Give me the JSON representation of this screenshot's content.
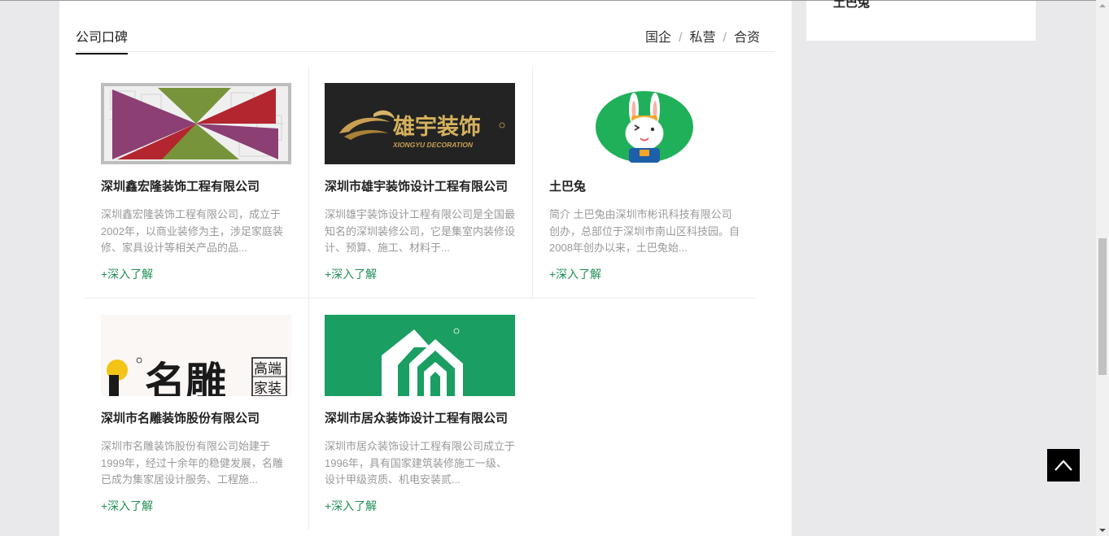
{
  "side_panel": {
    "cut_text": "土巴兔"
  },
  "section": {
    "title": "公司口碑",
    "filters": [
      "国企",
      "私营",
      "合资"
    ],
    "separator": "/"
  },
  "companies": [
    {
      "name": "深圳鑫宏隆装饰工程有限公司",
      "desc": "深圳鑫宏隆装饰工程有限公司，成立于2002年，以商业装修为主，涉足家庭装修、家具设计等相关产品的品...",
      "more": "+深入了解",
      "logo_icon": "pinwheel-logo"
    },
    {
      "name": "深圳市雄宇装饰设计工程有限公司",
      "desc": "深圳雄宇装饰设计工程有限公司是全国最知名的深圳装修公司，它是集室内装修设计、预算、施工、材料于...",
      "more": "+深入了解",
      "logo_icon": "xiongyu-logo",
      "logo_text": "雄宇装饰",
      "logo_subtext": "XIONGYU DECORATION"
    },
    {
      "name": "土巴兔",
      "desc": "简介 土巴兔由深圳市彬讯科技有限公司创办，总部位于深圳市南山区科技园。自2008年创办以来，土巴兔始...",
      "more": "+深入了解",
      "logo_icon": "rabbit-logo"
    },
    {
      "name": "深圳市名雕装饰股份有限公司",
      "desc": "深圳市名雕装饰股份有限公司始建于1999年，经过十余年的稳健发展，名雕已成为集家居设计服务、工程施...",
      "more": "+深入了解",
      "logo_icon": "mingdiao-logo",
      "logo_text": "名雕",
      "logo_tag_1": "高端",
      "logo_tag_2": "家装"
    },
    {
      "name": "深圳市居众装饰设计工程有限公司",
      "desc": "深圳市居众装饰设计工程有限公司成立于1996年，具有国家建筑装修施工一级、设计甲级资质、机电安装贰...",
      "more": "+深入了解",
      "logo_icon": "juzhong-logo"
    }
  ],
  "colors": {
    "link_green": "#1d8f56",
    "juzhong_green": "#1a9e62",
    "rabbit_green": "#20b05a"
  },
  "back_to_top": {
    "icon": "chevron-up-icon"
  }
}
